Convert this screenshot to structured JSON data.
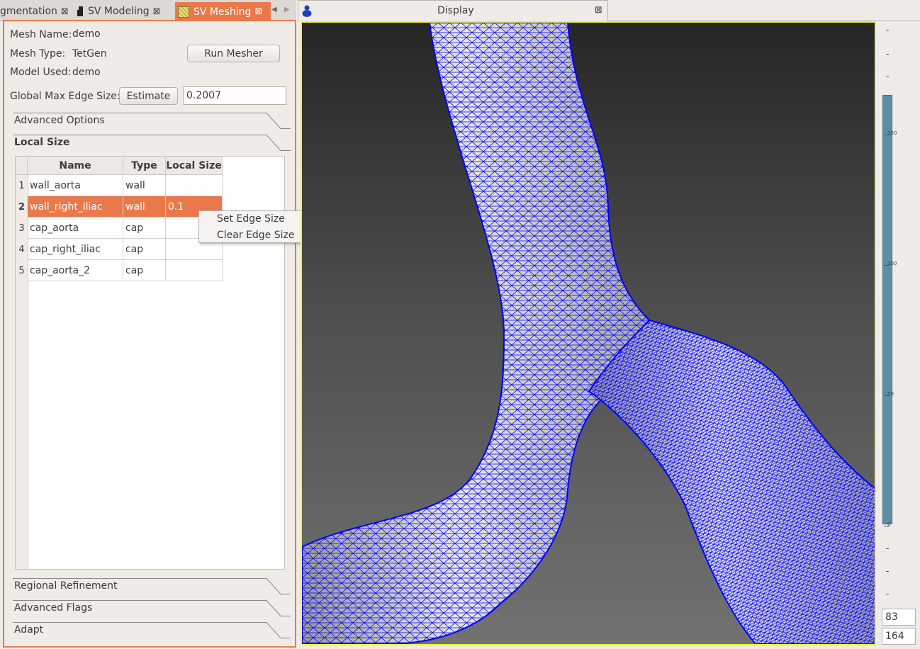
{
  "left_tabs": [
    {
      "label": "gmentation"
    },
    {
      "label": "SV Modeling"
    },
    {
      "label": "SV Meshing",
      "active": true
    }
  ],
  "right_tab": {
    "label": "Display"
  },
  "mesh": {
    "name_label": "Mesh Name:",
    "name_value": "demo",
    "type_label": "Mesh Type:",
    "type_value": "TetGen",
    "model_label": "Model Used:",
    "model_value": "demo",
    "run_button": "Run Mesher",
    "edge_label": "Global Max Edge Size:",
    "estimate_button": "Estimate",
    "edge_value": "0.2007"
  },
  "sections": {
    "advanced_options": "Advanced Options",
    "local_size": "Local Size",
    "regional_refinement": "Regional Refinement",
    "advanced_flags": "Advanced Flags",
    "adapt": "Adapt"
  },
  "table": {
    "headers": [
      "Name",
      "Type",
      "Local Size"
    ],
    "rows": [
      {
        "num": "1",
        "name": "wall_aorta",
        "type": "wall",
        "size": ""
      },
      {
        "num": "2",
        "name": "wall_right_iliac",
        "type": "wall",
        "size": "0.1",
        "selected": true
      },
      {
        "num": "3",
        "name": "cap_aorta",
        "type": "cap",
        "size": ""
      },
      {
        "num": "4",
        "name": "cap_right_iliac",
        "type": "cap",
        "size": ""
      },
      {
        "num": "5",
        "name": "cap_aorta_2",
        "type": "cap",
        "size": ""
      }
    ]
  },
  "context_menu": [
    "Set Edge Size",
    "Clear Edge Size"
  ],
  "scale": {
    "labels": [
      "150",
      "100",
      "50",
      "0"
    ],
    "spin_top": "83",
    "spin_bottom": "164",
    "bar_color": "#5c8ea6"
  },
  "colors": {
    "accent": "#e9794a",
    "viewport_border": "#f2f23a",
    "mesh_lines": "#0000ff"
  }
}
